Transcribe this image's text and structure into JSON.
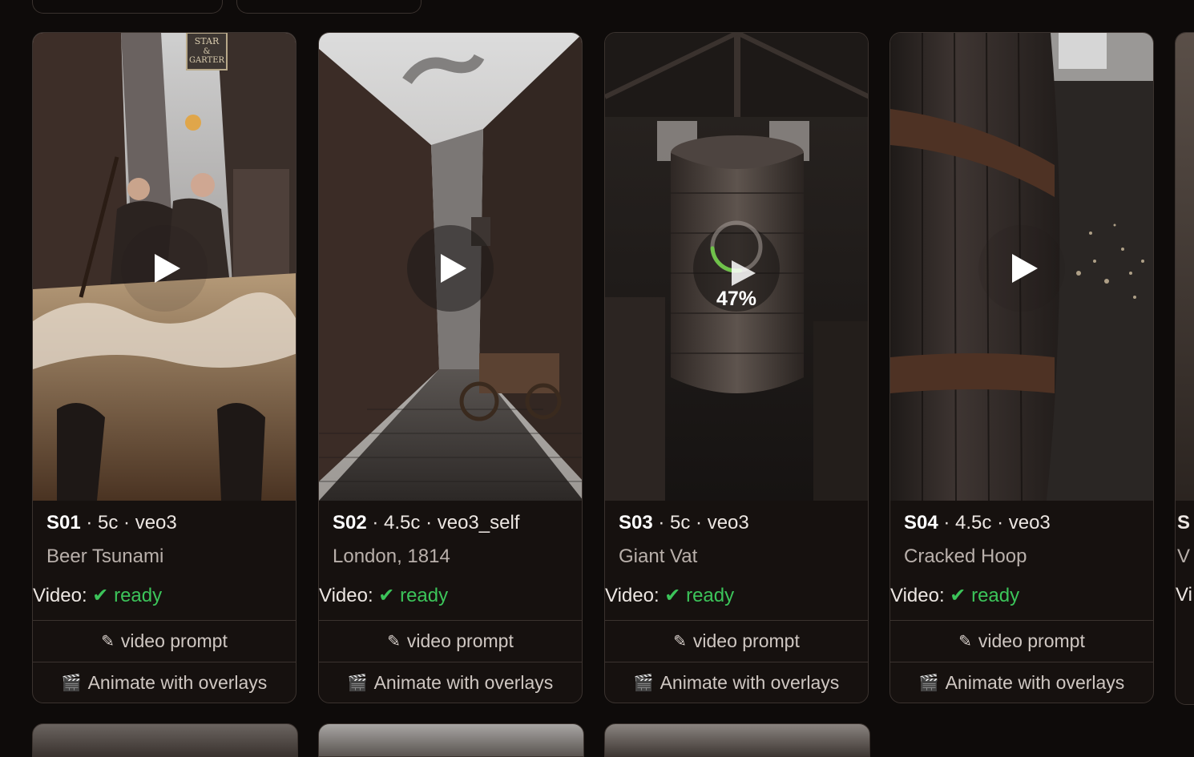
{
  "cards": [
    {
      "id": "S01",
      "meta": "· 5c · veo3",
      "title": "Beer Tsunami",
      "video_label": "Video:",
      "status": "✔ ready",
      "state": "play",
      "sign": [
        "STAR",
        "&",
        "GARTER"
      ]
    },
    {
      "id": "S02",
      "meta": "· 4.5c · veo3_self",
      "title": "London, 1814",
      "video_label": "Video:",
      "status": "✔ ready",
      "state": "play"
    },
    {
      "id": "S03",
      "meta": "· 5c · veo3",
      "title": "Giant Vat",
      "video_label": "Video:",
      "status": "✔ ready",
      "state": "progress",
      "progress": "47%"
    },
    {
      "id": "S04",
      "meta": "· 4.5c · veo3",
      "title": "Cracked Hoop",
      "video_label": "Video:",
      "status": "✔ ready",
      "state": "play"
    }
  ],
  "partial_card": {
    "id_initial": "S",
    "title_initial": "V",
    "video_initial": "Vi"
  },
  "buttons": {
    "video_prompt": "video prompt",
    "animate": "Animate with overlays"
  },
  "icons": {
    "video_prompt": "pencil-icon",
    "animate": "clapperboard-icon",
    "play": "play-icon"
  },
  "colors": {
    "ready": "#3cc45a",
    "background": "#0e0b0a",
    "card": "#16110f"
  }
}
